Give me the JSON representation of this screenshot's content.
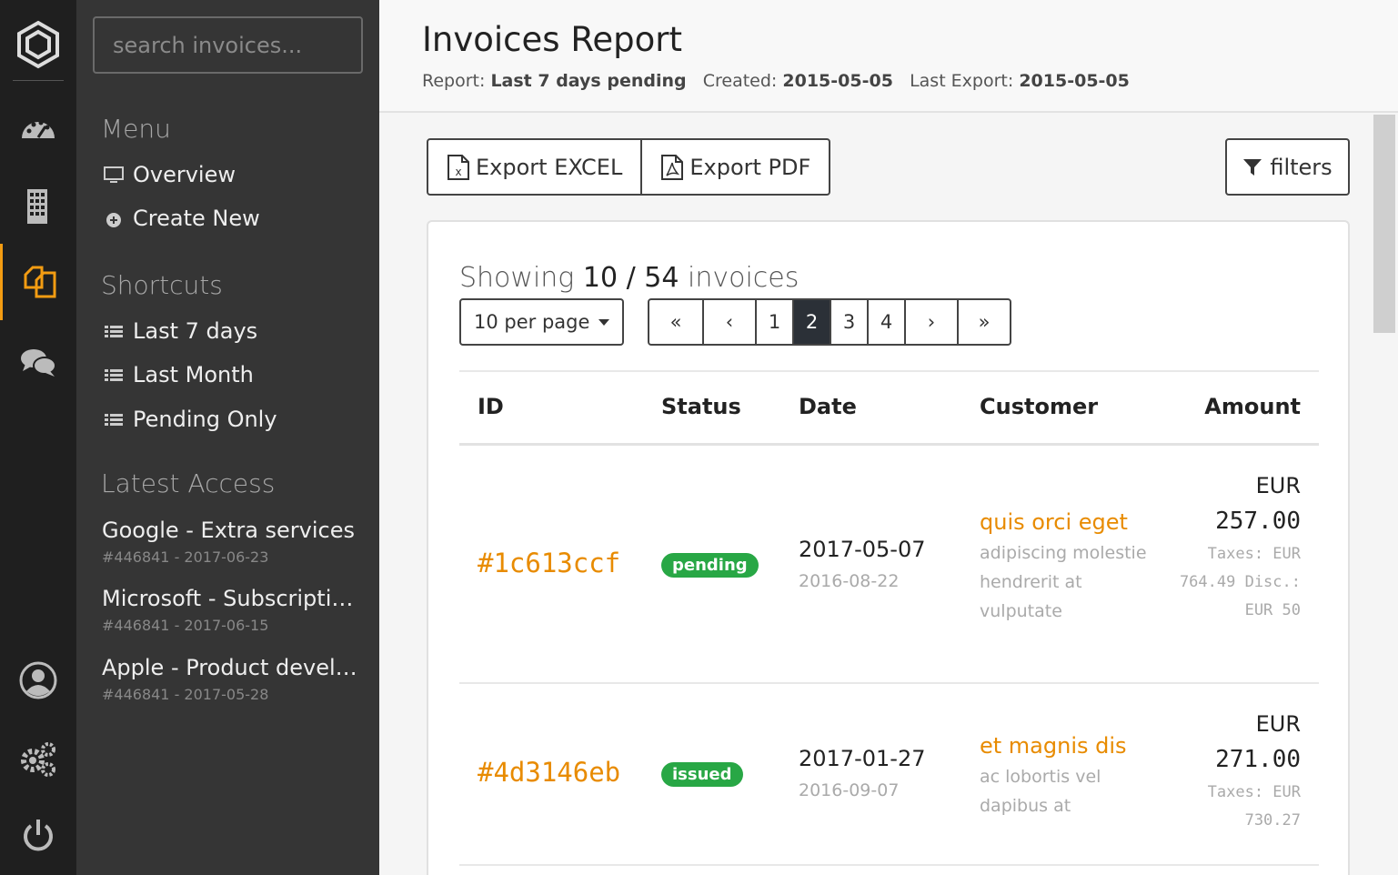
{
  "rail": {
    "items": [
      {
        "icon": "dashboard-icon"
      },
      {
        "icon": "building-icon"
      },
      {
        "icon": "documents-icon",
        "active": true
      },
      {
        "icon": "chat-icon"
      },
      {
        "icon": "user-icon"
      },
      {
        "icon": "gears-icon"
      },
      {
        "icon": "power-icon"
      }
    ],
    "accent": "#f39c12"
  },
  "sidebar": {
    "search_placeholder": "search invoices...",
    "menu_heading": "Menu",
    "menu": [
      {
        "label": "Overview",
        "icon": "monitor-icon"
      },
      {
        "label": "Create New",
        "icon": "plus-circle-icon"
      }
    ],
    "shortcuts_heading": "Shortcuts",
    "shortcuts": [
      {
        "label": "Last 7 days",
        "icon": "list-icon"
      },
      {
        "label": "Last Month",
        "icon": "list-icon"
      },
      {
        "label": "Pending Only",
        "icon": "list-icon"
      }
    ],
    "recent_heading": "Latest Access",
    "recent": [
      {
        "title": "Google - Extra services",
        "sub": "#446841 - 2017-06-23"
      },
      {
        "title": "Microsoft - Subscriptions",
        "sub": "#446841 - 2017-06-15"
      },
      {
        "title": "Apple - Product development",
        "sub": "#446841 - 2017-05-28"
      }
    ]
  },
  "header": {
    "title": "Invoices Report",
    "report_label": "Report:",
    "report_value": "Last 7 days pending",
    "created_label": "Created:",
    "created_value": "2015-05-05",
    "export_label": "Last Export:",
    "export_value": "2015-05-05"
  },
  "toolbar": {
    "export_excel": "Export EXCEL",
    "export_pdf": "Export PDF",
    "filters": "filters"
  },
  "listing": {
    "showing_prefix": "Showing",
    "shown": "10",
    "separator": "/",
    "total": "54",
    "suffix": "invoices",
    "per_page": "10 per page",
    "pager": {
      "first": "«",
      "prev": "‹",
      "pages": [
        "1",
        "2",
        "3",
        "4"
      ],
      "active_page": "2",
      "next": "›",
      "last": "»"
    }
  },
  "table": {
    "headers": {
      "id": "ID",
      "status": "Status",
      "date": "Date",
      "customer": "Customer",
      "amount": "Amount"
    },
    "rows": [
      {
        "id": "#1c613ccf",
        "status": "pending",
        "date": "2017-05-07",
        "date2": "2016-08-22",
        "customer": "quis orci eget",
        "desc": "adipiscing molestie hendrerit at vulputate",
        "currency": "EUR",
        "amount": "257.00",
        "extra": "Taxes: EUR 764.49 Disc.: EUR 50"
      },
      {
        "id": "#4d3146eb",
        "status": "issued",
        "date": "2017-01-27",
        "date2": "2016-09-07",
        "customer": "et magnis dis",
        "desc": "ac lobortis vel dapibus at",
        "currency": "EUR",
        "amount": "271.00",
        "extra": "Taxes: EUR 730.27"
      }
    ]
  }
}
